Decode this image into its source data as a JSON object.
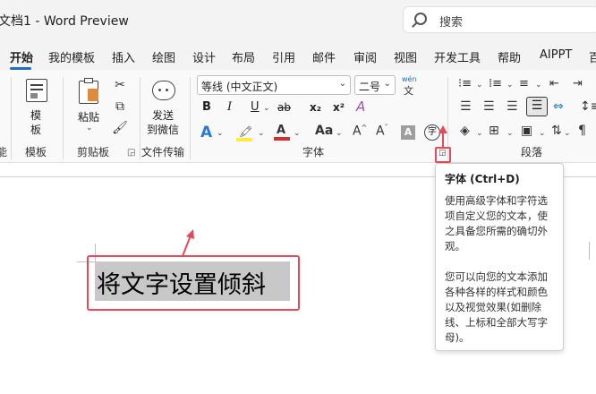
{
  "window": {
    "title": "文档1  -  Word Preview"
  },
  "search": {
    "placeholder": "搜索"
  },
  "tabs": [
    {
      "label": "开始",
      "active": true
    },
    {
      "label": "我的模板"
    },
    {
      "label": "插入"
    },
    {
      "label": "绘图"
    },
    {
      "label": "设计"
    },
    {
      "label": "布局"
    },
    {
      "label": "引用"
    },
    {
      "label": "邮件"
    },
    {
      "label": "审阅"
    },
    {
      "label": "视图"
    },
    {
      "label": "开发工具"
    },
    {
      "label": "帮助"
    },
    {
      "label": "AIPPT"
    },
    {
      "label": "百"
    }
  ],
  "ribbon": {
    "groups": {
      "partial_left": "能",
      "template": "模板",
      "clipboard": "剪贴板",
      "file_transfer": "文件传输",
      "font": "字体",
      "paragraph": "段落"
    },
    "template_button": "模\n板",
    "template_button_l1": "模",
    "template_button_l2": "板",
    "paste_button": "粘贴",
    "send_button_l1": "发送",
    "send_button_l2": "到微信",
    "font_name": "等线 (中文正文)",
    "font_size": "二号",
    "phonetic_top": "wén",
    "phonetic_bottom": "文",
    "bold": "B",
    "italic": "I",
    "underline": "U",
    "strike": "ab",
    "subscript": "x₂",
    "superscript": "x²",
    "text_effect": "A",
    "highlight": "ab",
    "font_color": "A",
    "grow_font": "A^",
    "shrink_font": "A˅",
    "char_shading": "A",
    "enclose_char": "字"
  },
  "document": {
    "text": "将文字设置倾斜"
  },
  "tooltip": {
    "title": "字体 (Ctrl+D)",
    "body1": "使用高级字体和字符选项自定义您的文本，使之具备您所需的确切外观。",
    "body2": "您可以向您的文本添加各种各样的样式和颜色以及视觉效果(如删除线、上标和全部大写字母)。"
  },
  "colors": {
    "accent": "#1f6dc2",
    "annotation": "#e5495b",
    "highlight_yellow": "#ffeb3b",
    "font_red": "#d32f2f"
  }
}
